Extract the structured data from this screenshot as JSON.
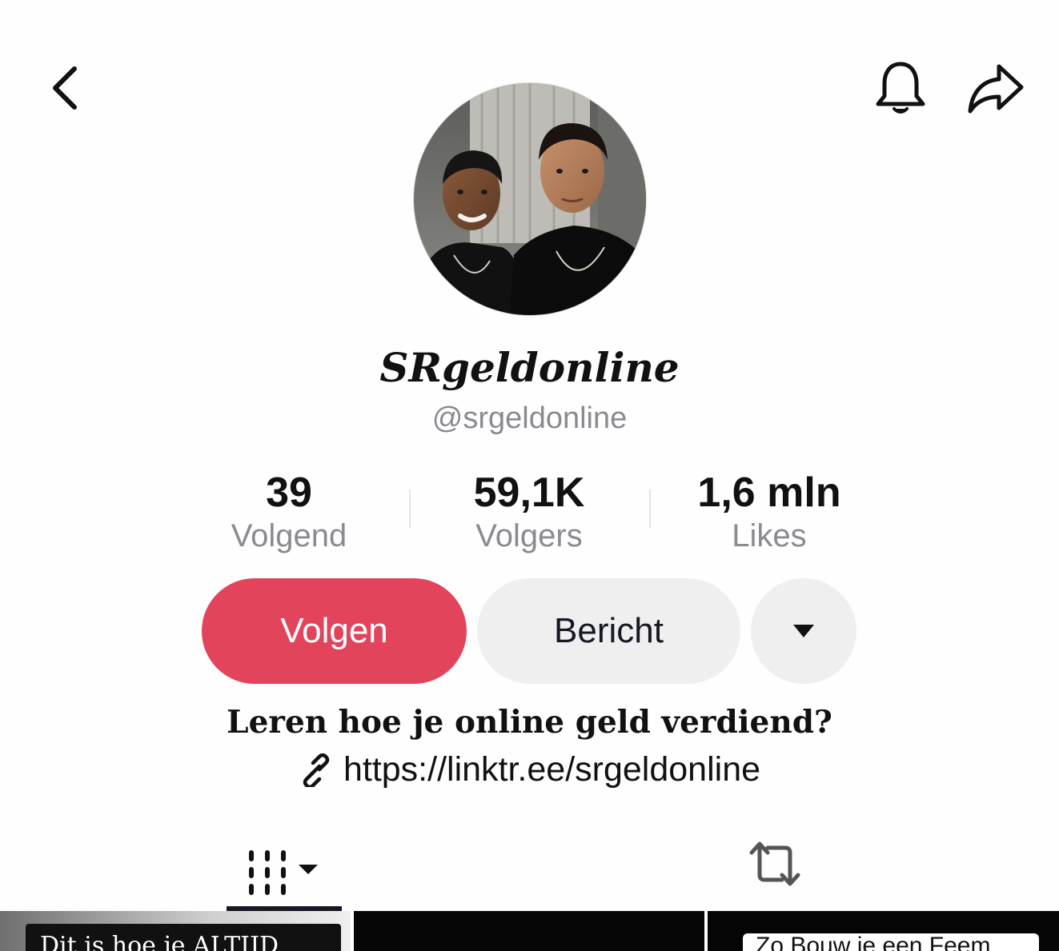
{
  "header": {
    "back_icon": "chevron-left-icon",
    "bell_icon": "bell-icon",
    "share_icon": "share-arrow-icon"
  },
  "profile": {
    "display_name": "SRgeldonline",
    "handle": "@srgeldonline"
  },
  "stats": [
    {
      "value": "39",
      "label": "Volgend"
    },
    {
      "value": "59,1K",
      "label": "Volgers"
    },
    {
      "value": "1,6 mln",
      "label": "Likes"
    }
  ],
  "actions": {
    "follow_label": "Volgen",
    "message_label": "Bericht",
    "more_icon": "caret-down-icon"
  },
  "bio": {
    "text": "Leren hoe je online geld verdiend?",
    "link": "https://linktr.ee/srgeldonline",
    "link_icon": "link-icon"
  },
  "tabs": {
    "videos_icon": "video-grid-icon",
    "reposts_icon": "repost-icon"
  },
  "thumbnails": [
    {
      "caption": "Dit is hoe je ALTIJD"
    },
    {
      "caption": ""
    },
    {
      "caption": "Zo Bouw je een Feem"
    }
  ],
  "colors": {
    "accent": "#e2445c",
    "secondary_button": "#efefef",
    "muted_text": "#8a8b91"
  }
}
